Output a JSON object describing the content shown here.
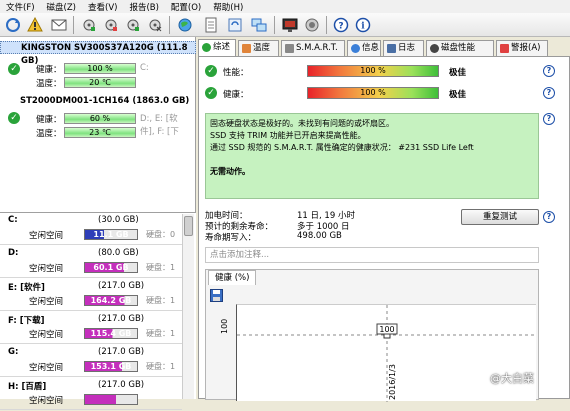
{
  "menu": [
    "文件(F)",
    "磁盘(Z)",
    "查看(V)",
    "报告(B)",
    "配置(O)",
    "帮助(H)"
  ],
  "disks": [
    {
      "title": "KINGSTON SV300S37A120G (111.8 GB)",
      "health_label": "健康：",
      "health_value": "100 %",
      "temp_label": "温度：",
      "temp_value": "20 ℃",
      "drives": "C:"
    },
    {
      "title": "ST2000DM001-1CH164 (1863.0 GB)",
      "health_label": "健康：",
      "health_value": "60 %",
      "temp_label": "温度：",
      "temp_value": "23 ℃",
      "drives": "D:, E: [软件], F: [下载], G:, H: [百盾], I: [其它]"
    }
  ],
  "volumes": [
    {
      "name": "C:",
      "size": "(30.0 GB)",
      "free_label": "空闲空间",
      "free": "11.1 GB",
      "disk": "硬盘：0",
      "color": "#2f3fb8",
      "free_fraction": 0.37
    },
    {
      "name": "D:",
      "size": "(80.0 GB)",
      "free_label": "空闲空间",
      "free": "60.1 GB",
      "disk": "硬盘：1",
      "color": "#c42fbc",
      "free_fraction": 0.75
    },
    {
      "name": "E: [软件]",
      "size": "(217.0 GB)",
      "free_label": "空闲空间",
      "free": "164.2 GB",
      "disk": "硬盘：1",
      "color": "#c42fbc",
      "free_fraction": 0.76
    },
    {
      "name": "F: [下载]",
      "size": "(217.0 GB)",
      "free_label": "空闲空间",
      "free": "115.4 GB",
      "disk": "硬盘：1",
      "color": "#c42fbc",
      "free_fraction": 0.53
    },
    {
      "name": "G:",
      "size": "(217.0 GB)",
      "free_label": "空闲空间",
      "free": "153.1 GB",
      "disk": "硬盘：1",
      "color": "#c42fbc",
      "free_fraction": 0.71
    },
    {
      "name": "H: [百盾]",
      "size": "(217.0 GB)",
      "free_label": "空闲空间",
      "free": "",
      "disk": "",
      "color": "#c42fbc",
      "free_fraction": 0.6
    }
  ],
  "tabs": [
    "综述",
    "温度",
    "S.M.A.R.T.",
    "信息",
    "日志",
    "磁盘性能",
    "警报(A)"
  ],
  "summary": {
    "performance_label": "性能：",
    "performance_value": "100 %",
    "performance_status": "极佳",
    "health_label": "健康：",
    "health_value": "100 %",
    "health_status": "极佳",
    "desc_lines": [
      "固态硬盘状态是极好的。未找到有问题的或坏扇区。",
      "SSD 支持 TRIM 功能并已开启来提高性能。",
      "通过 SSD 规范的 S.M.A.R.T. 属性确定的健康状况：  #231 SSD Life Left",
      "",
      "无需动作。"
    ],
    "power_on_label": "加电时间：",
    "power_on_value": "11 日, 19 小时",
    "remaining_label": "预计的剩余寿命：",
    "remaining_value": "多于 1000 日",
    "written_label": "寿命期写入：",
    "written_value": "498.00 GB",
    "retest_button": "重复测试",
    "note_placeholder": "点击添加注释...",
    "health_tab": "健康 (%)",
    "chart_ylabel": "100",
    "chart_point_label": "100",
    "chart_xlabel": "2016/1/3"
  },
  "chart_data": {
    "type": "line",
    "x": [
      "2016/1/3"
    ],
    "series": [
      {
        "values": [
          100
        ]
      }
    ],
    "ylabel_tick": "100"
  },
  "watermark": "@大白菜",
  "colors": {
    "accent_green": "#2aa33a",
    "help_blue": "#1d4fa8",
    "selection": "#cfe2fb"
  }
}
